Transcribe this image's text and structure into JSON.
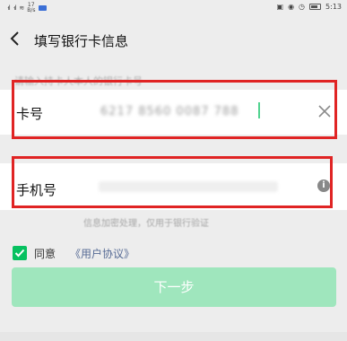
{
  "status_bar": {
    "signal_1": "ᐧıl",
    "signal_2": "ᐧıl",
    "wifi": "≋",
    "net_speed": "17 B/s",
    "time": "5:13"
  },
  "header": {
    "title": "填写银行卡信息"
  },
  "hint": "请输入持卡人本人的银行卡号",
  "card": {
    "label": "卡号",
    "value": "6217 8560 0087 788"
  },
  "phone": {
    "label": "手机号"
  },
  "privacy_note": "信息加密处理，仅用于银行验证",
  "agreement": {
    "label": "同意",
    "link": "《用户协议》"
  },
  "next_button": "下一步",
  "colors": {
    "accent": "#07c160",
    "annotation": "#e02424",
    "link": "#576b95"
  },
  "icons": [
    "back-arrow-icon",
    "clear-icon",
    "info-icon",
    "checkmark-icon"
  ]
}
